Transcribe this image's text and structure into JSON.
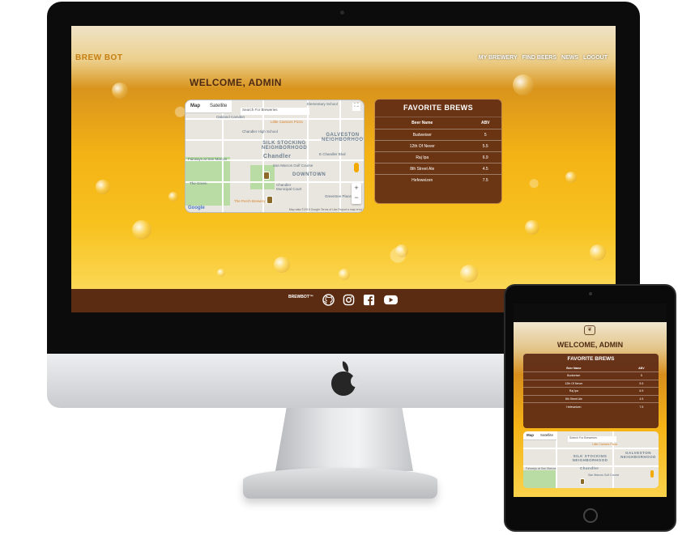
{
  "site": {
    "brand": "BREW BOT",
    "nav": [
      "MY BREWERY",
      "FIND BEERS",
      "NEWS",
      "LOGOUT"
    ],
    "welcome": "WELCOME, ADMIN",
    "footer_brand": "BREWBOT™"
  },
  "map": {
    "tabs": [
      "Map",
      "Satellite"
    ],
    "search_placeholder": "Search For Breweries",
    "zoom_in": "+",
    "zoom_out": "−",
    "fullscreen": "⛶",
    "google": "Google",
    "attribution": "Map data ©2019 Google   Terms of Use   Report a map error",
    "labels": {
      "elementary_school": "Elementary School",
      "oakland_camden": "Oakland Camden",
      "little_caesars": "Little Caesars Pizza",
      "chandler_high": "Chandler High School",
      "galveston": "GALVESTON NEIGHBORHOOD",
      "silk_stocking": "SILK STOCKING NEIGHBORHOOD",
      "chandler": "Chandler",
      "fairways": "Fairways at San Marcos",
      "san_marcos_golf": "San Marcos Golf Course",
      "downtown": "DOWNTOWN",
      "chandler_court": "Chandler Municipal Court",
      "greentree": "Greentree Place",
      "the_green": "The Green",
      "perch": "The Perch Brewery",
      "chandler_blvd": "E Chandler Blvd"
    }
  },
  "favorites": {
    "title": "FAVORITE BREWS",
    "headers": [
      "Beer Name",
      "ABV"
    ],
    "rows": [
      {
        "name": "Budweiser",
        "abv": "5"
      },
      {
        "name": "12th Of Never",
        "abv": "5.5"
      },
      {
        "name": "Raj Ipa",
        "abv": "6.9"
      },
      {
        "name": "8th Street Ale",
        "abv": "4.5"
      },
      {
        "name": "Hefeweizen",
        "abv": "7.5"
      }
    ]
  },
  "social": [
    "github-icon",
    "instagram-icon",
    "facebook-icon",
    "youtube-icon"
  ],
  "colors": {
    "brand": "#c57f12",
    "card_bg": "#5e2a14",
    "footer_bg": "#5c2c12",
    "welcome_text": "#4e2a14"
  }
}
